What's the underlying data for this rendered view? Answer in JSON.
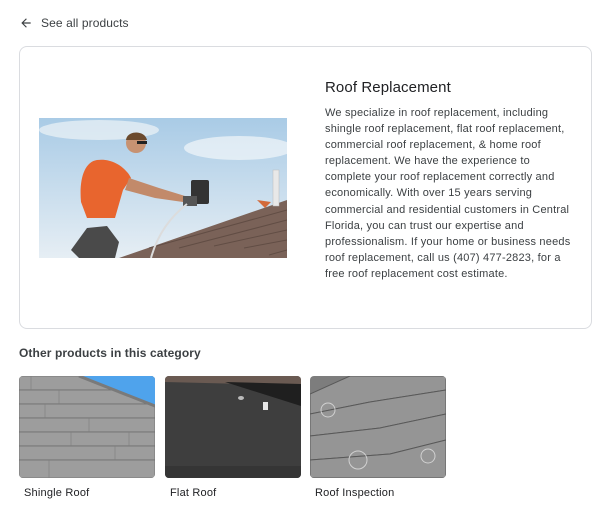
{
  "back_link": {
    "label": "See all products",
    "icon": "arrow-left-icon"
  },
  "product": {
    "title": "Roof Replacement",
    "description": "We specialize in roof replacement, including shingle roof replacement, flat roof replacement, commercial roof replacement, & home roof replacement. We have the experience to complete your roof replacement correctly and economically. With over 15 years serving commercial and residential customers in Central Florida, you can trust our expertise and professionalism. If your home or business needs roof replacement, call us (407) 477-2823, for a free roof replacement cost estimate."
  },
  "related": {
    "heading": "Other products in this category",
    "items": [
      {
        "label": "Shingle Roof"
      },
      {
        "label": "Flat Roof"
      },
      {
        "label": "Roof Inspection"
      }
    ]
  }
}
